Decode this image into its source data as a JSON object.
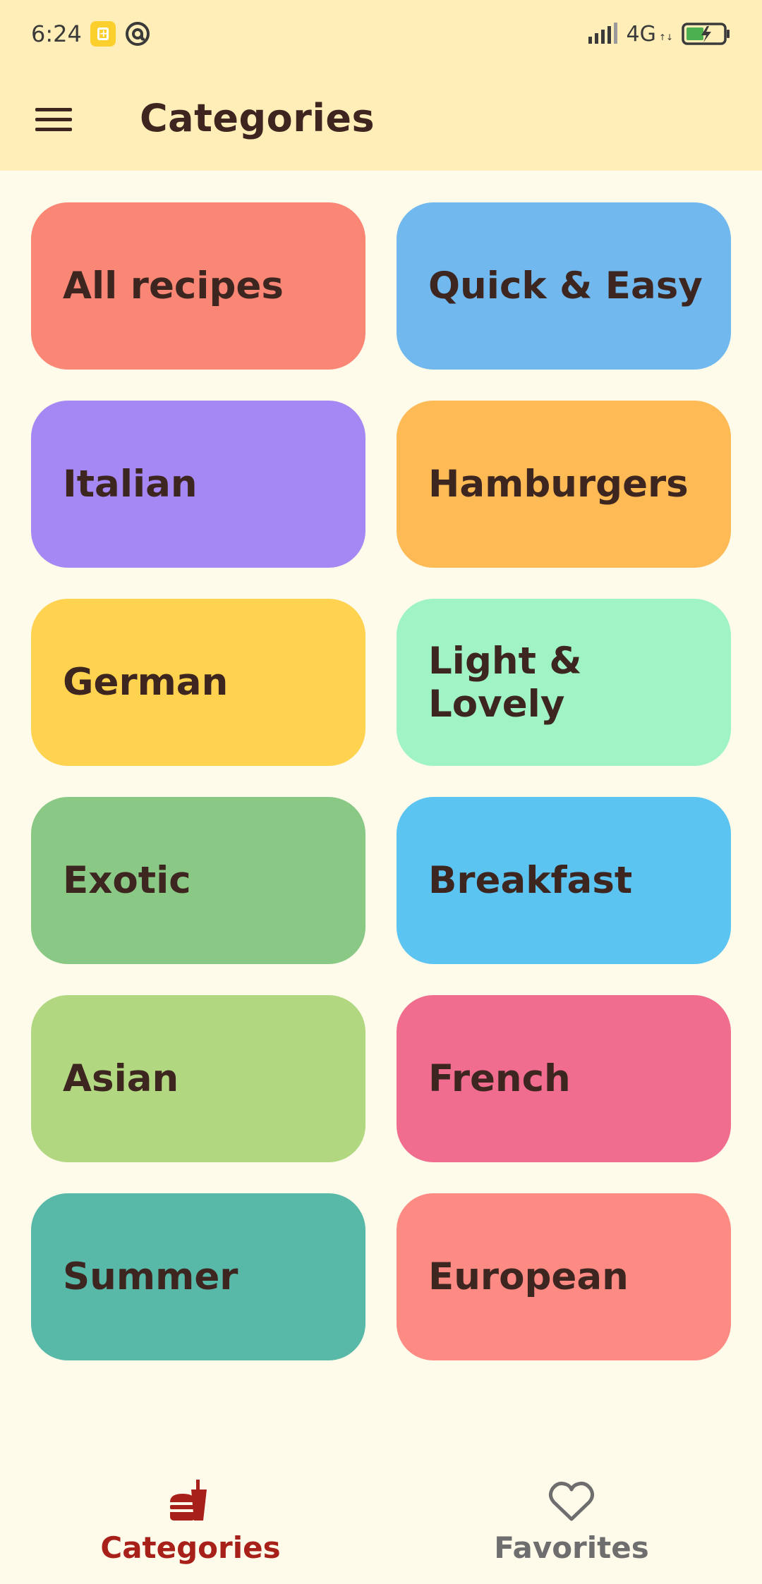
{
  "status_bar": {
    "time": "6:24",
    "network": "4G",
    "icons": [
      "battery-saver-icon",
      "at-sign-icon",
      "signal-icon",
      "battery-charging-icon"
    ]
  },
  "app_bar": {
    "title": "Categories",
    "menu_icon": "hamburger-menu-icon"
  },
  "categories": [
    {
      "label": "All recipes",
      "color": "#fa8676"
    },
    {
      "label": "Quick & Easy",
      "color": "#71b8ee"
    },
    {
      "label": "Italian",
      "color": "#a688f5"
    },
    {
      "label": "Hamburgers",
      "color": "#fdba55"
    },
    {
      "label": "German",
      "color": "#ffd34f"
    },
    {
      "label": "Light & Lovely",
      "color": "#9ff3c4"
    },
    {
      "label": "Exotic",
      "color": "#8ac985"
    },
    {
      "label": "Breakfast",
      "color": "#5cc4f1"
    },
    {
      "label": "Asian",
      "color": "#b2d781"
    },
    {
      "label": "French",
      "color": "#f06d90"
    },
    {
      "label": "Summer",
      "color": "#59b9a8"
    },
    {
      "label": "European",
      "color": "#fe8a84"
    }
  ],
  "bottom_nav": {
    "items": [
      {
        "label": "Categories",
        "icon": "fast-food-icon",
        "active": true
      },
      {
        "label": "Favorites",
        "icon": "heart-outline-icon",
        "active": false
      }
    ],
    "active_color": "#a8201a",
    "inactive_color": "#6e6e6e"
  }
}
